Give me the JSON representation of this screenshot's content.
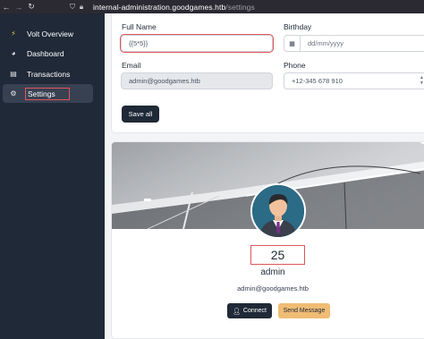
{
  "browser": {
    "back_icon": "arrow-left-icon",
    "forward_icon": "arrow-right-icon",
    "reload_icon": "reload-icon",
    "url_host": "internal-administration.goodgames.htb",
    "url_path": "/settings"
  },
  "sidebar": {
    "items": [
      {
        "label": "Volt Overview",
        "icon": "lightning-icon"
      },
      {
        "label": "Dashboard",
        "icon": "pie-chart-icon"
      },
      {
        "label": "Transactions",
        "icon": "card-icon"
      },
      {
        "label": "Settings",
        "icon": "gear-icon",
        "active": true
      }
    ]
  },
  "form": {
    "full_name_label": "Full Name",
    "full_name_value": "{{5*5}}",
    "birthday_label": "Birthday",
    "birthday_placeholder": "dd/mm/yyyy",
    "email_label": "Email",
    "email_value": "admin@goodgames.htb",
    "phone_label": "Phone",
    "phone_value": "+12-345 678 910",
    "save_label": "Save all"
  },
  "profile": {
    "injected_result": "25",
    "name": "admin",
    "email": "admin@goodgames.htb",
    "connect_label": "Connect",
    "send_label": "Send Message"
  },
  "colors": {
    "sidebar_bg": "#1f2937",
    "highlight": "#e0555a",
    "send_button": "#f0bc74"
  }
}
